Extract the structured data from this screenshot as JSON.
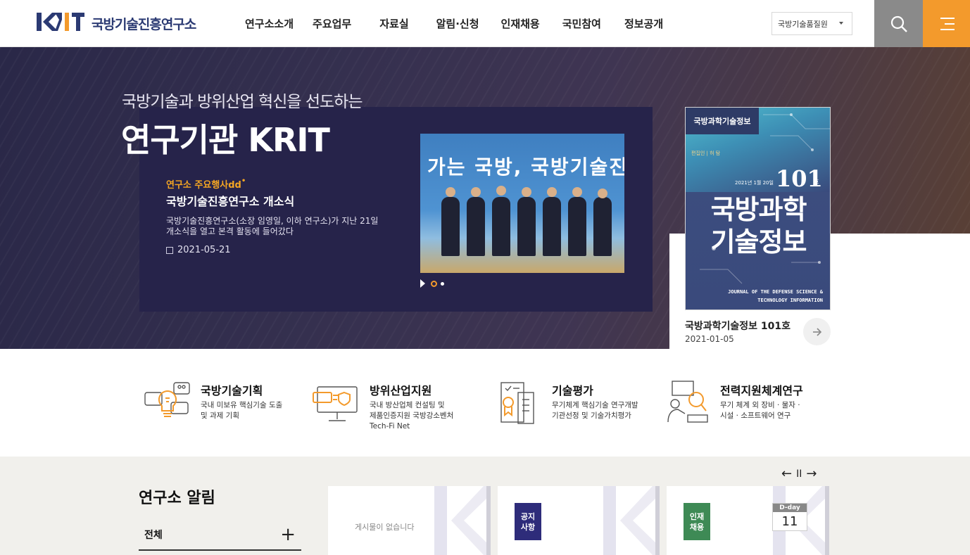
{
  "header": {
    "logo_text": "국방기술진흥연구소",
    "nav": [
      "연구소소개",
      "주요업무",
      "자료실",
      "알림·신청",
      "인재채용",
      "국민참여",
      "정보공개"
    ],
    "site_select": "국방기술품질원",
    "search_icon": "search-icon",
    "menu_icon": "hamburger-menu-icon",
    "colors": {
      "brand_navy": "#2b3a73",
      "brand_orange": "#f39a2c"
    }
  },
  "hero": {
    "subtitle": "국방기술과 방위산업 혁신을 선도하는",
    "title": "연구기관 KRIT",
    "card": {
      "tag": "연구소 주요행사dd",
      "tag_mark": "•",
      "title": "국방기술진흥연구소 개소식",
      "desc": "국방기술진흥연구소(소장 임영일, 이하 연구소)가 지난 21일 개소식을 열고 본격 활동에 들어갔다",
      "date": "2021-05-21",
      "photo_banner": "가는 국방, 국방기술진흥"
    }
  },
  "journal": {
    "tag": "국방과학기술정보",
    "editor": "편집인 | 허 탐",
    "issue_date": "2021년 1월 20일",
    "number": "101",
    "ho": "호",
    "cover_title_1": "국방과학",
    "cover_title_2": "기술정보",
    "cover_english_1": "JOURNAL OF THE DEFENSE SCIENCE &",
    "cover_english_2": "TECHNOLOGY INFORMATION",
    "caption": "국방과학기술정보 101호",
    "date": "2021-01-05"
  },
  "services": [
    {
      "title": "국방기술기획",
      "desc": [
        "국내 미보유 핵심기술 도출",
        "및 과제 기획"
      ]
    },
    {
      "title": "방위산업지원",
      "desc": [
        "국내 방산업체 컨설팅 및",
        "제품인증지원 국방강소벤처",
        "Tech-Fi Net"
      ]
    },
    {
      "title": "기술평가",
      "desc": [
        "무기체계 핵심기술 연구개발",
        "기관선정 및 기술가치평가"
      ]
    },
    {
      "title": "전력지원체계연구",
      "desc": [
        "무기 체계 외 장비 · 물자 ·",
        "시설 · 소프트웨어 연구"
      ]
    }
  ],
  "notice": {
    "title": "연구소 알림",
    "filter": "전체",
    "plus": "+",
    "prev": "←",
    "pause": "II",
    "next": "→",
    "empty": "게시물이 없습니다",
    "badge_notice": "공지\n사항",
    "badge_notice_1": "공지",
    "badge_notice_2": "사항",
    "badge_job_1": "인재",
    "badge_job_2": "채용",
    "dday_label": "D-day",
    "dday_value": "11",
    "colors": {
      "notice_badge": "#2e2c7a",
      "job_badge": "#3e8a55"
    }
  }
}
